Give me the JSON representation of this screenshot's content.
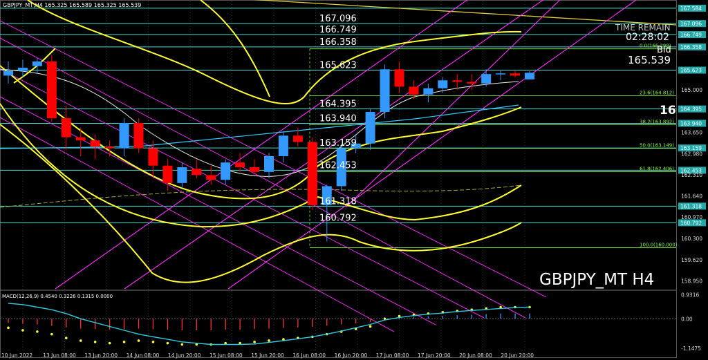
{
  "header": {
    "symbol_info": "GBPJPY_MT,H4  165.325 165.589 165.325 165.539",
    "watermark": "GBPJPY_MT H4",
    "time_remain_label": "TIME REMAIN",
    "time_remain_value": "02:28:02",
    "bid_label": "Bid",
    "bid_value": "165.539",
    "cut_price": "16"
  },
  "colors": {
    "bull": "#3399ff",
    "bear": "#ff0000",
    "level_line": "#40e0d0",
    "bands": "#ffff33",
    "channel": "#ff33ff",
    "fib": "#88ff44",
    "ma_white": "#e8e8e8",
    "ma_cyan": "#33ccff",
    "price_tag_bg": "#22aaaa"
  },
  "chart_data": {
    "type": "candlestick",
    "title": "GBPJPY_MT H4",
    "ylim": [
      158.7,
      167.8
    ],
    "x_labels": [
      "10 Jun 2022",
      "13 Jun 08:00",
      "13 Jun 20:00",
      "14 Jun 08:00",
      "14 Jun 20:00",
      "15 Jun 08:00",
      "15 Jun 20:00",
      "16 Jun 08:00",
      "16 Jun 20:00",
      "17 Jun 08:00",
      "17 Jun 20:00",
      "20 Jun 08:00",
      "20 Jun 20:00"
    ],
    "y_ticks": [
      "167.584",
      "167.096",
      "166.749",
      "166.358",
      "165.623",
      "165.000",
      "164.395",
      "163.940",
      "163.650",
      "163.159",
      "162.980",
      "162.453",
      "162.310",
      "161.640",
      "161.318",
      "160.970",
      "160.792",
      "160.300",
      "159.620",
      "158.950"
    ],
    "candles": [
      {
        "o": 165.45,
        "h": 165.9,
        "l": 165.2,
        "c": 165.6
      },
      {
        "o": 165.6,
        "h": 165.95,
        "l": 165.4,
        "c": 165.7
      },
      {
        "o": 165.75,
        "h": 166.0,
        "l": 165.5,
        "c": 165.9
      },
      {
        "o": 165.9,
        "h": 166.1,
        "l": 164.0,
        "c": 164.1
      },
      {
        "o": 164.1,
        "h": 164.5,
        "l": 163.1,
        "c": 163.5
      },
      {
        "o": 163.5,
        "h": 163.8,
        "l": 162.9,
        "c": 163.4
      },
      {
        "o": 163.4,
        "h": 163.6,
        "l": 162.8,
        "c": 163.2
      },
      {
        "o": 163.2,
        "h": 163.4,
        "l": 162.9,
        "c": 163.15
      },
      {
        "o": 163.15,
        "h": 164.1,
        "l": 162.9,
        "c": 163.95
      },
      {
        "o": 163.95,
        "h": 164.1,
        "l": 163.0,
        "c": 163.15
      },
      {
        "o": 163.15,
        "h": 163.4,
        "l": 162.2,
        "c": 162.6
      },
      {
        "o": 162.6,
        "h": 162.8,
        "l": 161.8,
        "c": 162.05
      },
      {
        "o": 162.05,
        "h": 162.7,
        "l": 161.9,
        "c": 162.55
      },
      {
        "o": 162.5,
        "h": 162.8,
        "l": 162.2,
        "c": 162.3
      },
      {
        "o": 162.3,
        "h": 162.6,
        "l": 162.0,
        "c": 162.15
      },
      {
        "o": 162.15,
        "h": 162.8,
        "l": 162.0,
        "c": 162.7
      },
      {
        "o": 162.7,
        "h": 163.0,
        "l": 162.4,
        "c": 162.55
      },
      {
        "o": 162.55,
        "h": 162.8,
        "l": 162.3,
        "c": 162.4
      },
      {
        "o": 162.4,
        "h": 163.0,
        "l": 162.2,
        "c": 162.9
      },
      {
        "o": 162.9,
        "h": 163.7,
        "l": 162.7,
        "c": 163.55
      },
      {
        "o": 163.55,
        "h": 163.8,
        "l": 163.2,
        "c": 163.35
      },
      {
        "o": 163.35,
        "h": 163.5,
        "l": 161.2,
        "c": 161.35
      },
      {
        "o": 161.35,
        "h": 162.0,
        "l": 160.2,
        "c": 161.95
      },
      {
        "o": 161.95,
        "h": 163.3,
        "l": 161.8,
        "c": 163.15
      },
      {
        "o": 163.15,
        "h": 163.6,
        "l": 163.0,
        "c": 163.3
      },
      {
        "o": 163.3,
        "h": 164.4,
        "l": 163.1,
        "c": 164.3
      },
      {
        "o": 164.3,
        "h": 165.8,
        "l": 164.1,
        "c": 165.65
      },
      {
        "o": 165.65,
        "h": 165.9,
        "l": 164.9,
        "c": 165.1
      },
      {
        "o": 165.1,
        "h": 165.3,
        "l": 164.7,
        "c": 164.85
      },
      {
        "o": 164.85,
        "h": 165.2,
        "l": 164.6,
        "c": 165.05
      },
      {
        "o": 165.05,
        "h": 165.4,
        "l": 164.9,
        "c": 165.3
      },
      {
        "o": 165.3,
        "h": 165.5,
        "l": 165.0,
        "c": 165.25
      },
      {
        "o": 165.25,
        "h": 165.5,
        "l": 165.0,
        "c": 165.2
      },
      {
        "o": 165.2,
        "h": 165.65,
        "l": 165.1,
        "c": 165.5
      },
      {
        "o": 165.5,
        "h": 165.6,
        "l": 165.3,
        "c": 165.52
      },
      {
        "o": 165.52,
        "h": 165.6,
        "l": 165.4,
        "c": 165.45
      },
      {
        "o": 165.33,
        "h": 165.59,
        "l": 165.33,
        "c": 165.54
      }
    ],
    "levels": [
      {
        "price": 167.584,
        "label": ""
      },
      {
        "price": 167.096,
        "label": "167.096"
      },
      {
        "price": 166.749,
        "label": "166.749"
      },
      {
        "price": 166.358,
        "label": "166.358"
      },
      {
        "price": 165.623,
        "label": "165.623"
      },
      {
        "price": 164.395,
        "label": "164.395"
      },
      {
        "price": 163.94,
        "label": "163.940"
      },
      {
        "price": 163.159,
        "label": "163.159"
      },
      {
        "price": 162.453,
        "label": "162.453"
      },
      {
        "price": 161.318,
        "label": "161.318"
      },
      {
        "price": 160.792,
        "label": "160.792"
      }
    ],
    "fib_levels": [
      {
        "price": 166.298,
        "label": "0.0(166.298)"
      },
      {
        "price": 164.812,
        "label": "23.6(164.812)"
      },
      {
        "price": 163.892,
        "label": "38.2(163.892)"
      },
      {
        "price": 163.149,
        "label": "50.0(163.149)"
      },
      {
        "price": 162.406,
        "label": "61.8(162.406)"
      },
      {
        "price": 160.0,
        "label": "100.0(160.000)"
      }
    ],
    "macd": {
      "label": "MACD(12,26,9) 0.4540 0.3226 0.1315 0.0000",
      "ylim": [
        -1.2,
        1.0
      ],
      "y_ticks": [
        "0.9316",
        "0.00",
        "-1.1475"
      ],
      "histogram": [
        -0.35,
        -0.45,
        -0.5,
        -0.6,
        -0.75,
        -0.85,
        -0.9,
        -0.95,
        -0.9,
        -0.85,
        -0.9,
        -0.95,
        -1.0,
        -1.0,
        -1.0,
        -0.95,
        -0.95,
        -0.9,
        -0.85,
        -0.8,
        -0.75,
        -0.7,
        -0.6,
        -0.5,
        -0.4,
        -0.3,
        0.0,
        0.1,
        0.15,
        0.2,
        0.25,
        0.3,
        0.35,
        0.4,
        0.45,
        0.45,
        0.45
      ],
      "signal": [
        0.6,
        0.55,
        0.45,
        0.35,
        0.2,
        0.0,
        -0.15,
        -0.3,
        -0.45,
        -0.6,
        -0.7,
        -0.8,
        -0.9,
        -0.95,
        -1.0,
        -1.0,
        -1.0,
        -0.98,
        -0.92,
        -0.85,
        -0.78,
        -0.7,
        -0.6,
        -0.48,
        -0.35,
        -0.22,
        -0.05,
        0.05,
        0.12,
        0.18,
        0.22,
        0.28,
        0.32,
        0.36,
        0.4,
        0.43,
        0.45
      ]
    }
  }
}
